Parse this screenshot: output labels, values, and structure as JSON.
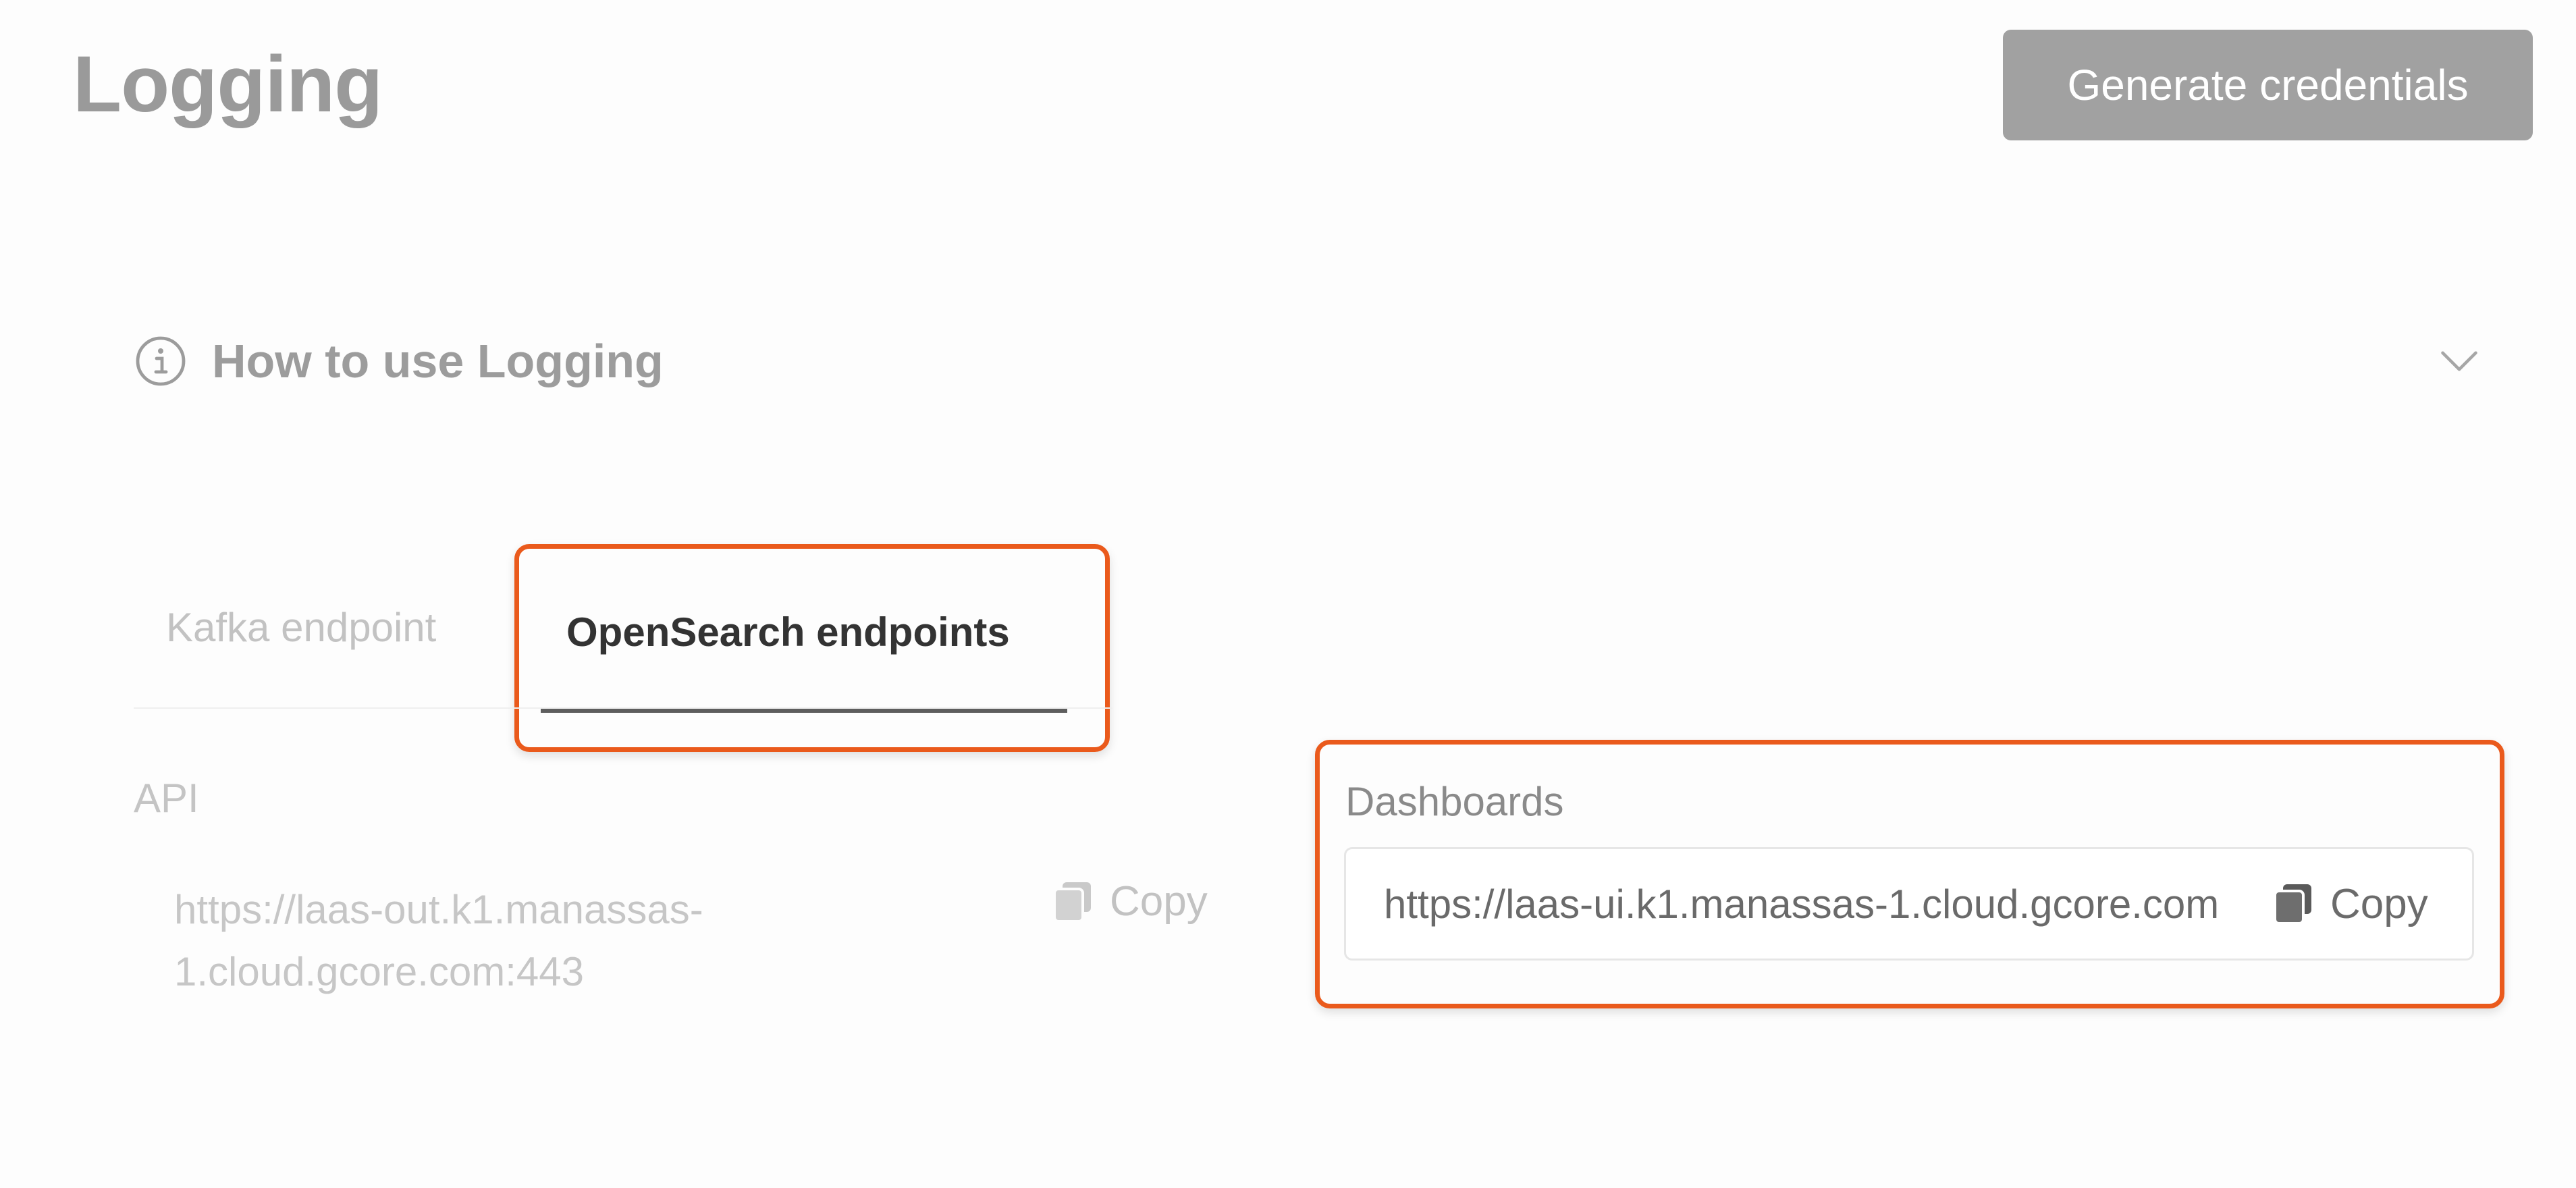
{
  "header": {
    "title": "Logging",
    "generate_button": "Generate credentials"
  },
  "help": {
    "label": "How to use Logging",
    "icon": "info-icon",
    "toggle_icon": "chevron-down-icon"
  },
  "tabs": [
    {
      "label": "Kafka endpoint",
      "active": false
    },
    {
      "label": "OpenSearch endpoints",
      "active": true
    }
  ],
  "endpoints": {
    "api": {
      "label": "API",
      "url_line1": "https://laas-out.k1.manassas-",
      "url_line2": "1.cloud.gcore.com:443",
      "copy_label": "Copy"
    },
    "dashboards": {
      "label": "Dashboards",
      "url": "https://laas-ui.k1.manassas-1.cloud.gcore.com",
      "copy_label": "Copy"
    }
  },
  "colors": {
    "highlight": "#ea5a1c",
    "button_bg": "#a1a1a1"
  }
}
